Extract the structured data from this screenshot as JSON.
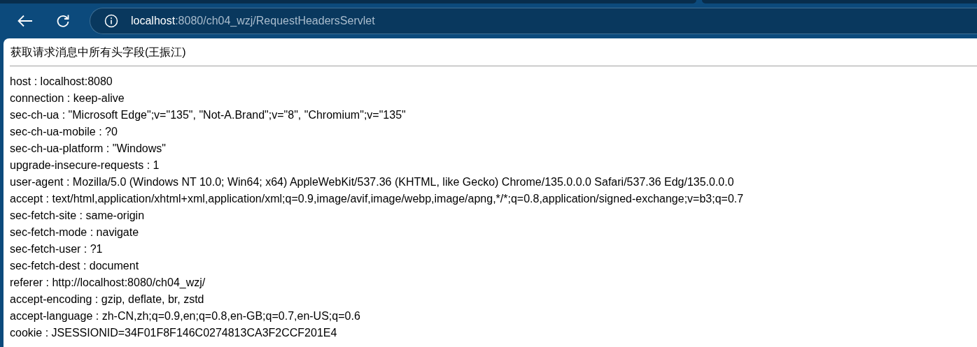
{
  "address_bar": {
    "host": "localhost",
    "path": ":8080/ch04_wzj/RequestHeadersServlet"
  },
  "page": {
    "heading": "获取请求消息中所有头字段(王振江)",
    "lines": [
      "host : localhost:8080",
      "connection : keep-alive",
      "sec-ch-ua : \"Microsoft Edge\";v=\"135\", \"Not-A.Brand\";v=\"8\", \"Chromium\";v=\"135\"",
      "sec-ch-ua-mobile : ?0",
      "sec-ch-ua-platform : \"Windows\"",
      "upgrade-insecure-requests : 1",
      "user-agent : Mozilla/5.0 (Windows NT 10.0; Win64; x64) AppleWebKit/537.36 (KHTML, like Gecko) Chrome/135.0.0.0 Safari/537.36 Edg/135.0.0.0",
      "accept : text/html,application/xhtml+xml,application/xml;q=0.9,image/avif,image/webp,image/apng,*/*;q=0.8,application/signed-exchange;v=b3;q=0.7",
      "sec-fetch-site : same-origin",
      "sec-fetch-mode : navigate",
      "sec-fetch-user : ?1",
      "sec-fetch-dest : document",
      "referer : http://localhost:8080/ch04_wzj/",
      "accept-encoding : gzip, deflate, br, zstd",
      "accept-language : zh-CN,zh;q=0.9,en;q=0.8,en-GB;q=0.7,en-US;q=0.6",
      "cookie : JSESSIONID=34F01F8F146C0274813CA3F2CCF201E4"
    ]
  }
}
